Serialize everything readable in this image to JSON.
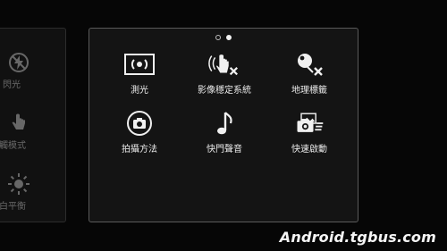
{
  "left_panel": {
    "items": [
      {
        "label": "閃光",
        "icon": "flash-off-icon"
      },
      {
        "label": "觸模式",
        "icon": "touch-icon"
      },
      {
        "label": "白平衡",
        "icon": "sun-icon"
      }
    ]
  },
  "pagination": {
    "total": 2,
    "active": 2
  },
  "tiles": [
    {
      "label": "測光",
      "icon": "metering-icon"
    },
    {
      "label": "影像穩定系統",
      "icon": "stabilization-off-icon"
    },
    {
      "label": "地理標籤",
      "icon": "geotag-off-icon"
    },
    {
      "label": "拍攝方法",
      "icon": "shutter-mode-icon"
    },
    {
      "label": "快門聲音",
      "icon": "shutter-sound-icon"
    },
    {
      "label": "快速啟動",
      "icon": "quick-launch-icon"
    }
  ],
  "watermark": "Android.tgbus.com"
}
